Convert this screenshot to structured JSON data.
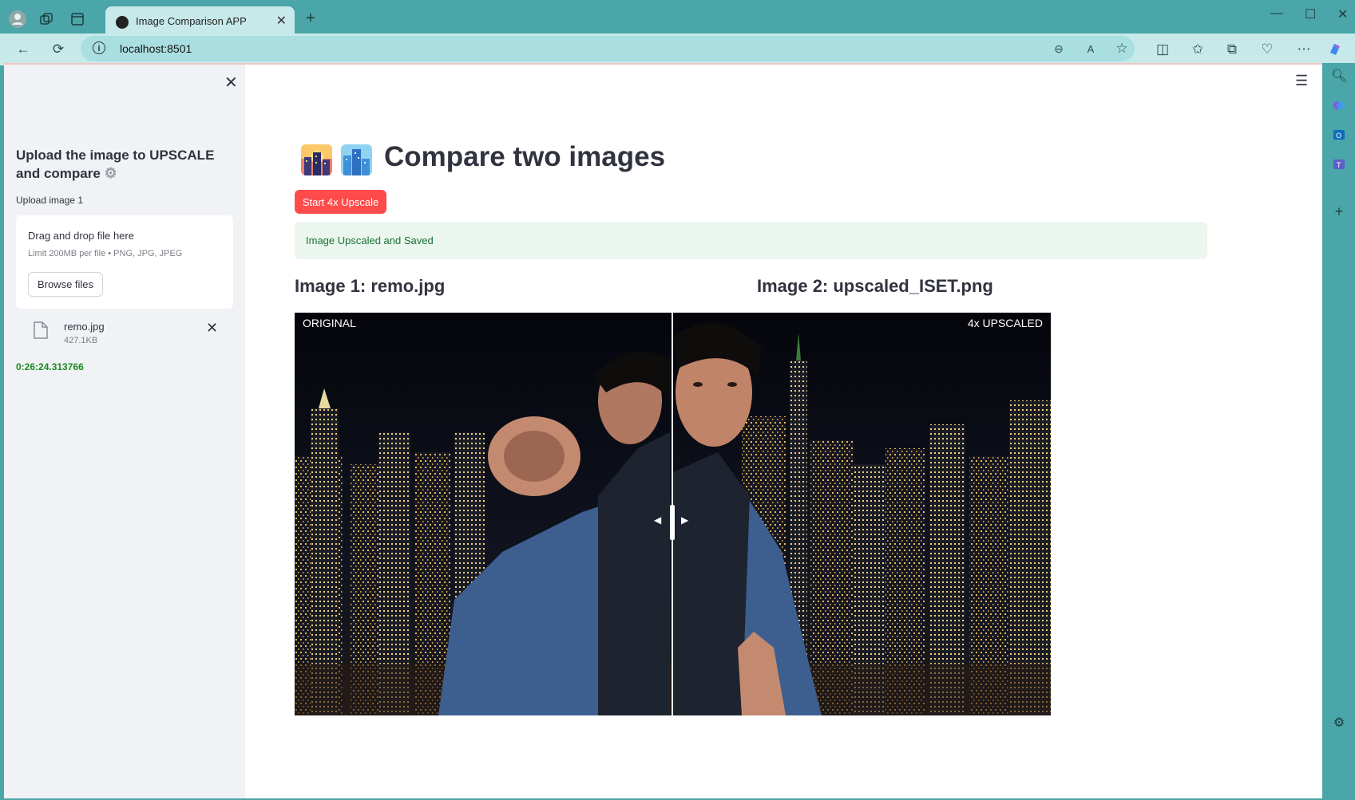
{
  "browser": {
    "tab_title": "Image Comparison APP",
    "url": "localhost:8501",
    "new_tab_symbol": "+",
    "tab_close_symbol": "✕"
  },
  "sidebar": {
    "heading": "Upload the image to UPSCALE and compare",
    "heading_icon": "gear-icon",
    "upload_label": "Upload image 1",
    "dropzone_title": "Drag and drop file here",
    "dropzone_limit": "Limit 200MB per file • PNG, JPG, JPEG",
    "browse_button": "Browse files",
    "file": {
      "name": "remo.jpg",
      "size": "427.1KB"
    },
    "elapsed": "0:26:24.313766"
  },
  "main": {
    "title": "Compare two images",
    "upscale_button": "Start 4x Upscale",
    "success_message": "Image Upscaled and Saved",
    "image1_heading": "Image 1: remo.jpg",
    "image2_heading": "Image 2: upscaled_ISET.png",
    "left_caption": "ORIGINAL",
    "right_caption": "4x UPSCALED",
    "slider_position": 0.5
  },
  "colors": {
    "accent": "#ff4b4b",
    "success_bg": "#ebf6ee",
    "success_text": "#177233",
    "sidebar_bg": "#f0f2f6",
    "browser_chrome": "#4aa6a8",
    "elapsed_text": "#198a1d"
  }
}
